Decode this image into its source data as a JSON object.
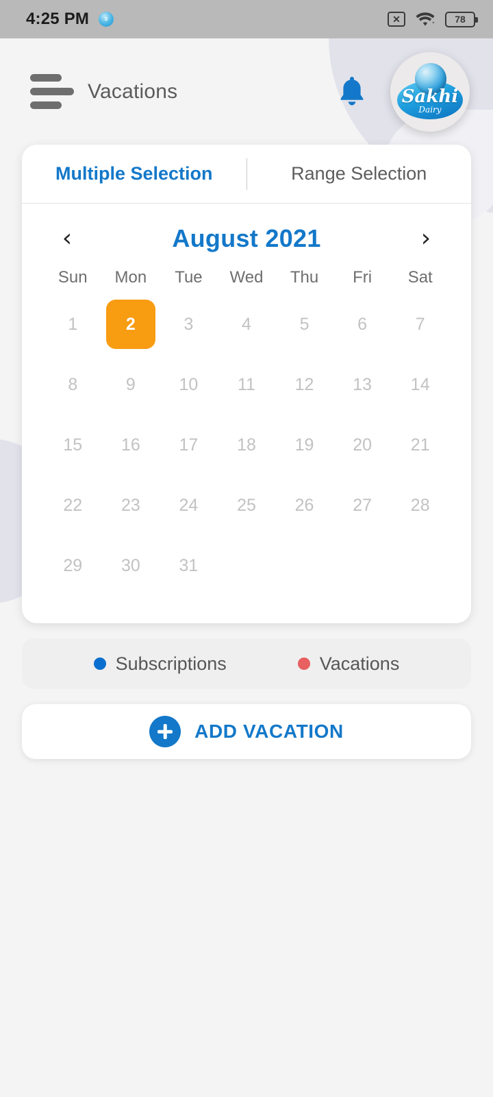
{
  "status_bar": {
    "time": "4:25 PM",
    "app_icon": "sakhi-app-icon",
    "no_sim_icon": "no-sim-icon",
    "no_sim_glyph": "✕",
    "wifi_icon": "wifi-icon",
    "battery_icon": "battery-icon",
    "battery_level": "78"
  },
  "header": {
    "menu_icon": "hamburger-menu-icon",
    "title": "Vacations",
    "bell_icon": "notification-bell-icon",
    "avatar": {
      "name": "Sakhi",
      "sub": "Dairy",
      "alt": "sakhi-dairy-logo"
    }
  },
  "tabs": [
    {
      "label": "Multiple Selection",
      "active": true
    },
    {
      "label": "Range Selection",
      "active": false
    }
  ],
  "calendar": {
    "prev_label": "‹",
    "next_label": "›",
    "month_label": "August 2021",
    "month": "August",
    "year": "2021",
    "weekdays": [
      "Sun",
      "Mon",
      "Tue",
      "Wed",
      "Thu",
      "Fri",
      "Sat"
    ],
    "leading_blanks": 0,
    "days": [
      "1",
      "2",
      "3",
      "4",
      "5",
      "6",
      "7",
      "8",
      "9",
      "10",
      "11",
      "12",
      "13",
      "14",
      "15",
      "16",
      "17",
      "18",
      "19",
      "20",
      "21",
      "22",
      "23",
      "24",
      "25",
      "26",
      "27",
      "28",
      "29",
      "30",
      "31"
    ],
    "selected_days": [
      "2"
    ],
    "selected_color": "#f89c12"
  },
  "legend": [
    {
      "label": "Subscriptions",
      "color": "#0b6fd0"
    },
    {
      "label": "Vacations",
      "color": "#e8605f"
    }
  ],
  "add_button": {
    "label": "ADD VACATION",
    "icon": "plus-icon"
  },
  "theme": {
    "accent_blue": "#1378c9",
    "orange": "#f89c12",
    "page_bg": "#f4f4f4",
    "status_bg": "#b9b9b9"
  }
}
